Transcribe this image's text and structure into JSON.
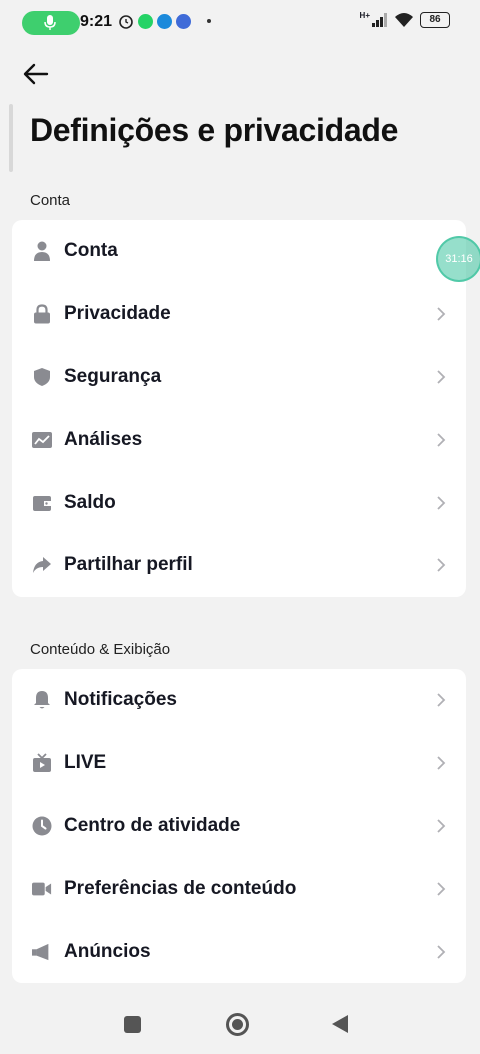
{
  "status_bar": {
    "time": "9:21",
    "battery": "86",
    "icons": [
      "microphone-icon",
      "alarm-icon",
      "whatsapp-icon",
      "chat-icon",
      "app-icon",
      "signal-icon",
      "wifi-icon",
      "battery-icon"
    ],
    "network": "H+"
  },
  "header": {
    "title": "Definições e privacidade"
  },
  "floating_timer": "31:16",
  "sections": [
    {
      "title": "Conta",
      "items": [
        {
          "label": "Conta",
          "icon": "person-icon"
        },
        {
          "label": "Privacidade",
          "icon": "lock-icon"
        },
        {
          "label": "Segurança",
          "icon": "shield-icon"
        },
        {
          "label": "Análises",
          "icon": "analytics-icon"
        },
        {
          "label": "Saldo",
          "icon": "wallet-icon"
        },
        {
          "label": "Partilhar perfil",
          "icon": "share-icon"
        }
      ]
    },
    {
      "title": "Conteúdo & Exibição",
      "items": [
        {
          "label": "Notificações",
          "icon": "bell-icon"
        },
        {
          "label": "LIVE",
          "icon": "live-icon"
        },
        {
          "label": "Centro de atividade",
          "icon": "clock-icon"
        },
        {
          "label": "Preferências de conteúdo",
          "icon": "video-icon"
        },
        {
          "label": "Anúncios",
          "icon": "megaphone-icon"
        }
      ]
    }
  ],
  "colors": {
    "background": "#f2f2f2",
    "card": "#ffffff",
    "text": "#161823",
    "icon": "#8a8b91",
    "chevron": "#b0b0b5",
    "mic_pill": "#3ecf6e"
  }
}
